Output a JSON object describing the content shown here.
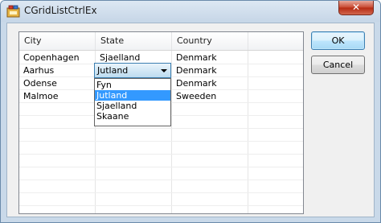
{
  "window": {
    "title": "CGridListCtrlEx",
    "close_glyph": "✕"
  },
  "grid": {
    "columns": [
      "City",
      "State",
      "Country"
    ],
    "rows": [
      {
        "city": "Copenhagen",
        "state": "Sjaelland",
        "country": "Denmark"
      },
      {
        "city": "Aarhus",
        "state": "",
        "country": "Denmark"
      },
      {
        "city": "Odense",
        "state": "",
        "country": "Denmark"
      },
      {
        "city": "Malmoe",
        "state": "",
        "country": "Sweeden"
      }
    ],
    "editor": {
      "value": "Jutland",
      "options": [
        "Fyn",
        "Jutland",
        "Sjaelland",
        "Skaane"
      ],
      "selected_index": 1
    }
  },
  "buttons": {
    "ok": "OK",
    "cancel": "Cancel"
  },
  "colors": {
    "selection": "#3399ff",
    "title_bar": "#c9d9e9",
    "close": "#c7462e"
  },
  "icons": {
    "app": "app-window-icon",
    "close": "close-icon",
    "dropdown": "chevron-down-icon"
  }
}
